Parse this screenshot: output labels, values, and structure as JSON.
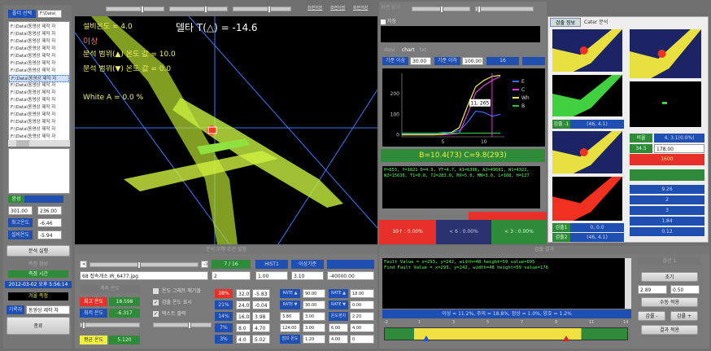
{
  "left": {
    "folder_button": "폴더 선택",
    "folder_path": "F:\\Data\\",
    "files": [
      "F:\\Data\\동영상 제작 자",
      "F:\\Data\\동영상 제작 자",
      "F:\\Data\\동영상 제작 자",
      "F:\\Data\\동영상 제작 자",
      "F:\\Data\\동영상 제작 자",
      "F:\\Data\\동영상 제작 자",
      "F:\\Data\\동영상 제작 자",
      "F:\\Data\\동영상 제작 자",
      "F:\\Data\\동영상 제작 자",
      "F:\\Data\\동영상 제작 자",
      "F:\\Data\\동영상 제작 자",
      "F:\\Data\\동영상 제작 자",
      "F:\\Data\\동영상 제작 자",
      "F:\\Data\\동영상 제작 자",
      "F:\\Data\\동영상 제작 자",
      "F:\\Data\\동영상 제작 자"
    ],
    "selected_index": 7,
    "status": "완성",
    "coord_x": "301.00",
    "coord_y": "236.00",
    "min_label": "최고온도",
    "min_value": "-6.46",
    "max_label": "설비온도",
    "max_value": "-5.94",
    "analyze_button": "분석 실행",
    "section_label": "측정 정보",
    "time_label": "측정 시간",
    "datetime": "2012-03-02 오후 5:56:14",
    "season_label": "겨울 측정",
    "person_label": "기록자",
    "person_value": "동영상 제작 자",
    "exit_button": "종료"
  },
  "image": {
    "equip_temp": "설비온도 = 4.0",
    "delta": "델타 T(△) = -14.6",
    "abnormal": "이상",
    "range_up": "분석 범위(▲) 온도 값 = 10.0",
    "range_down": "분석 범위(▼) 온도 값 = 0.0",
    "white_a": "White A = 0.0 %",
    "top_buttons": [
      "화면저장",
      "화면저장",
      "화면저장"
    ]
  },
  "analysis": {
    "title": "분석 수행 조건 설정",
    "prev": "<-",
    "next": "->",
    "counter": "7 / 16",
    "hist_button": "HIST1",
    "lot_button": "이상기준",
    "filename": "68 접속개소 IR_6477.jpg",
    "field1": "2",
    "field2": "1.00",
    "field3": "3.10",
    "field4": "-40000.00",
    "temp_title": "계측 온도",
    "max_temp_label": "최고 온도",
    "max_temp": "18.598",
    "min_temp_label": "최저 온도",
    "min_temp": "-6.317",
    "avg_temp_label": "평균 온도",
    "avg_temp": "5.120",
    "checks": [
      {
        "label": "온도 그래프 매기볼",
        "checked": false
      },
      {
        "label": "검출 온도 표시",
        "checked": true
      },
      {
        "label": "텍스트 출력",
        "checked": true
      }
    ],
    "pct_rows": [
      {
        "pct": "28%",
        "a": "32.0",
        "b": "-5.83"
      },
      {
        "pct": "21%",
        "a": "24.0",
        "b": "-0.04"
      },
      {
        "pct": "14%",
        "a": "16.0",
        "b": "3.98"
      },
      {
        "pct": "7%",
        "a": "8.0",
        "b": "4.70"
      },
      {
        "pct": "3%",
        "a": "4.0",
        "b": "5.02"
      }
    ],
    "rate_rows": [
      [
        "RATE ▲",
        "90.00",
        "RATE ▲",
        "18.00"
      ],
      [
        "RATE ▼",
        "30.00",
        "RATE ▼",
        "0.00"
      ],
      [
        "3.80",
        "3.00",
        "온도편차",
        "2.20"
      ],
      [
        "124.00",
        "3.00",
        "6.00",
        "4.00"
      ],
      [
        "점프 온도",
        "1.20",
        "4.00",
        "0"
      ]
    ]
  },
  "chart_panel": {
    "slider_label": "화면 밝기",
    "checkbox_label": "저장",
    "tabs": [
      "data",
      "chart",
      "txt"
    ],
    "active_tab": 1,
    "lo_label": "기준 이상",
    "lo_value": "30.00",
    "hi_label": "기준 이하",
    "hi_value": "100.00",
    "btn": "16",
    "result": "B=10.4(73) C=9.8(293)",
    "log": "P=653, Y=1821 D=4.9, YT=4.7, A1=6396, A2=49681, W1=4322, W2=15630, T1=0.0, T2=283.0, MX=5.0, MN=3.0, L=108, H=127",
    "stats": [
      "10↑ : 0.00%",
      "< 6 : 0.00%",
      "< 3 : 0.00%"
    ]
  },
  "chart_data": {
    "type": "line",
    "x": [
      0,
      1,
      2,
      3,
      4,
      5,
      6,
      7,
      8,
      9,
      10,
      11,
      12
    ],
    "series": [
      {
        "name": "E",
        "color": "#3a6cff",
        "values": [
          5,
          5,
          5,
          5,
          5,
          12,
          12,
          20,
          60,
          115,
          110,
          90,
          100
        ]
      },
      {
        "name": "C",
        "color": "#e040e0",
        "values": [
          0,
          0,
          0,
          0,
          0,
          0,
          3,
          8,
          100,
          205,
          240,
          265,
          285
        ]
      },
      {
        "name": "Wh",
        "color": "#f0f040",
        "values": [
          0,
          0,
          0,
          0,
          0,
          3,
          10,
          35,
          140,
          235,
          265,
          285,
          290
        ]
      },
      {
        "name": "B",
        "color": "#30c040",
        "values": [
          8,
          8,
          8,
          8,
          8,
          8,
          8,
          8,
          8,
          8,
          8,
          8,
          8
        ]
      }
    ],
    "yticks": [
      0,
      100,
      200
    ],
    "xticks": [
      5,
      10
    ],
    "xlim": [
      0,
      12.5
    ],
    "ylim": [
      -10,
      300
    ],
    "tooltip": "11, 265",
    "marker_x": 11
  },
  "right": {
    "tabs": [
      "검출 정보",
      "Cater 분석"
    ],
    "detect_label": "검출 -1",
    "detect_value": "(46, 4.1)",
    "label1": "검출1",
    "value1": "0, 0.0",
    "label2": "검출2",
    "value2": "(46, 4.1)",
    "ratio_label": "비율",
    "ratio_value": "4, 3.1(0.0%)",
    "r2_label": "34.5",
    "r2_value": "178.00",
    "alert": "1600",
    "values": [
      "9.26",
      "2",
      "3",
      "1.84",
      "0.12"
    ]
  },
  "result": {
    "title": "검출 결과",
    "log": [
      "Fault Value = x=293, y=242, width=48 height=59 value=695",
      "Find Fault Value = x=293, y=242, width=48 height=59 value=176"
    ],
    "summary": "이상 = 11.2%, 주의 = 18.8%, 정상 = 1.0%, 양호 = 1.2%",
    "scale": [
      "-2",
      "1",
      "3",
      "5",
      "7",
      "9",
      "11",
      "14"
    ],
    "blue_marker_value": 0.7,
    "red_marker_value": 9.9,
    "opt_title": "옵션 1",
    "reset": "초기",
    "v1": "2.89",
    "v2": "0.50",
    "apply_manual": "수동 적용",
    "dec": "감률 -",
    "inc": "감률 +",
    "apply_result": "결과 적용"
  }
}
